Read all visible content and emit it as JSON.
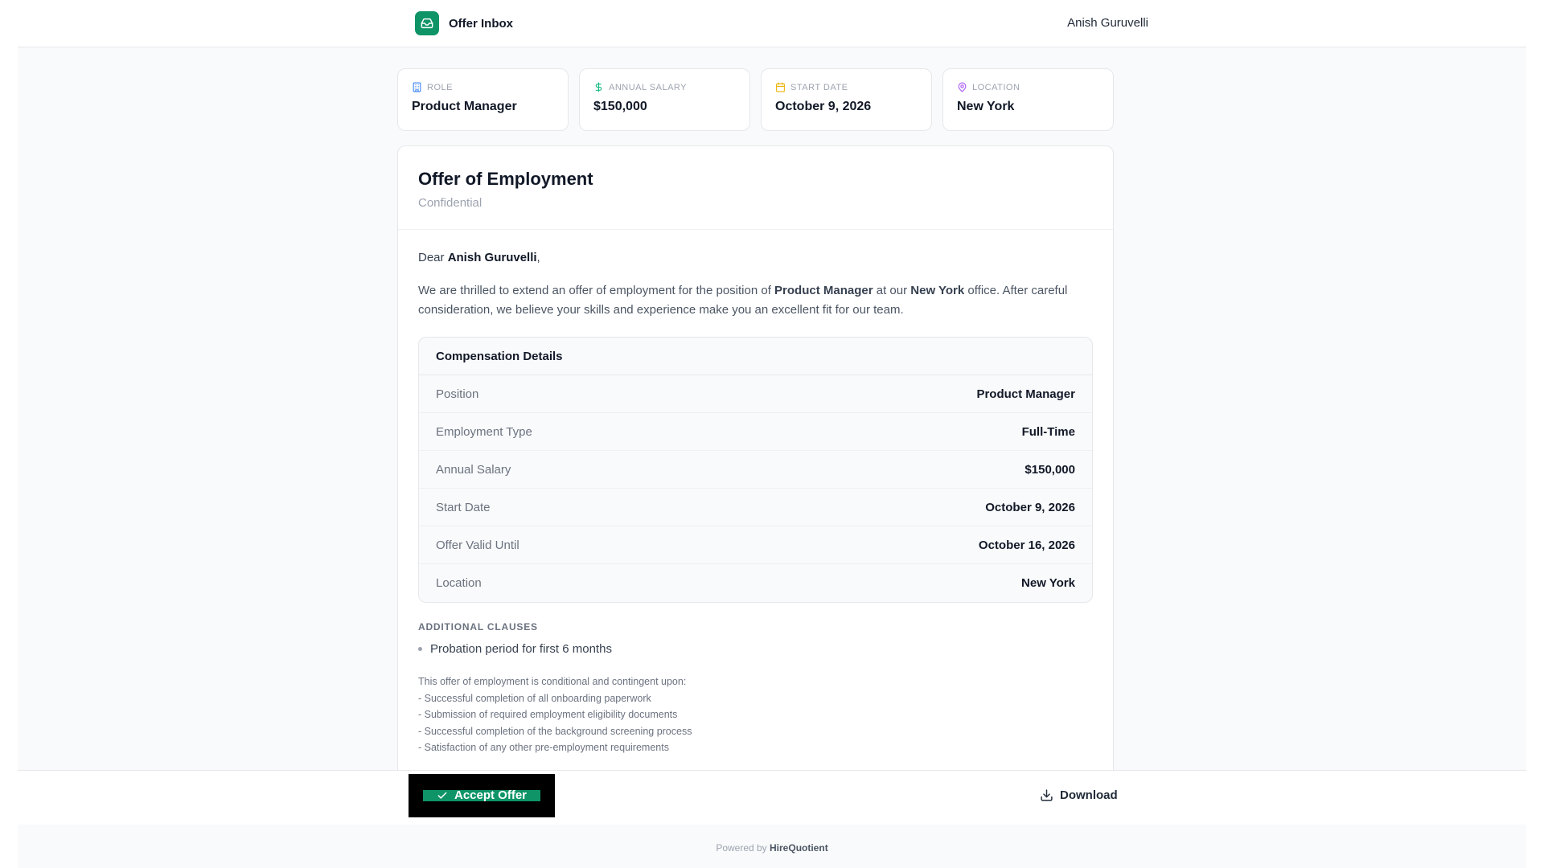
{
  "header": {
    "app_title": "Offer Inbox",
    "user_name": "Anish Guruvelli"
  },
  "summary_cards": [
    {
      "label": "Role",
      "value": "Product Manager",
      "icon": "building-icon",
      "icon_color": "#3b82f6"
    },
    {
      "label": "Annual Salary",
      "value": "$150,000",
      "icon": "dollar-icon",
      "icon_color": "#10b981"
    },
    {
      "label": "Start Date",
      "value": "October 9, 2026",
      "icon": "calendar-icon",
      "icon_color": "#eab308"
    },
    {
      "label": "Location",
      "value": "New York",
      "icon": "map-pin-icon",
      "icon_color": "#a855f7"
    }
  ],
  "letter": {
    "title": "Offer of Employment",
    "subtitle": "Confidential",
    "greeting_prefix": "Dear ",
    "recipient": "Anish Guruvelli",
    "greeting_suffix": ",",
    "intro_1": "We are thrilled to extend an offer of employment for the position of ",
    "intro_role": "Product Manager",
    "intro_2": " at our ",
    "intro_location": "New York",
    "intro_3": " office. After careful consideration, we believe your skills and experience make you an excellent fit for our team.",
    "compensation": {
      "title": "Compensation Details",
      "rows": [
        {
          "key": "Position",
          "value": "Product Manager"
        },
        {
          "key": "Employment Type",
          "value": "Full-Time"
        },
        {
          "key": "Annual Salary",
          "value": "$150,000"
        },
        {
          "key": "Start Date",
          "value": "October 9, 2026"
        },
        {
          "key": "Offer Valid Until",
          "value": "October 16, 2026"
        },
        {
          "key": "Location",
          "value": "New York"
        }
      ]
    },
    "clauses_title": "ADDITIONAL CLAUSES",
    "clauses": [
      "Probation period for first 6 months"
    ],
    "conditions": [
      "This offer of employment is conditional and contingent upon:",
      "- Successful completion of all onboarding paperwork",
      "- Submission of required employment eligibility documents",
      "- Successful completion of the background screening process",
      "- Satisfaction of any other pre-employment requirements"
    ]
  },
  "actions": {
    "accept_label": "Accept Offer",
    "download_label": "Download"
  },
  "footer": {
    "prefix": "Powered by ",
    "brand": "HireQuotient"
  },
  "colors": {
    "accent": "#0e9466"
  }
}
